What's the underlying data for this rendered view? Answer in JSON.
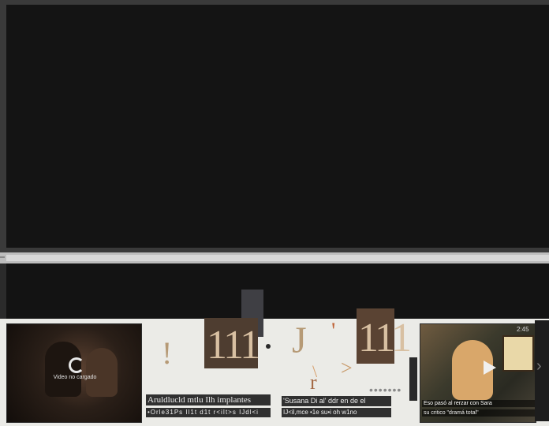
{
  "player": {
    "state": "blank"
  },
  "related": {
    "left_thumb": {
      "caption": "Video no cargado",
      "icon": "reload-icon"
    },
    "center_captions": {
      "card1_title": "Aruldlucld mtlu Ilh implantes",
      "card1_meta": "•Orle31Ps Il1t d1t r<iIt>s IJdl<i",
      "card2_title": "'Susana Di al' ddr en de el",
      "card2_meta": "IJ<il,mce •1e su•i oh w1no"
    },
    "artifact_glyphs": {
      "g1": "!",
      "g2": "111",
      "g3": "J",
      "g4": "'",
      "g5": "111",
      "g6": "\\",
      "g7": "r",
      "g8": ">",
      "dots": "•••••••"
    },
    "right_thumb": {
      "duration": "2:45",
      "title": "Eso pasó al rerzar con Sara",
      "subtitle": "su critico \"dramá total\"",
      "icon": "play-icon"
    },
    "next_icon": "chevron-right-icon"
  }
}
